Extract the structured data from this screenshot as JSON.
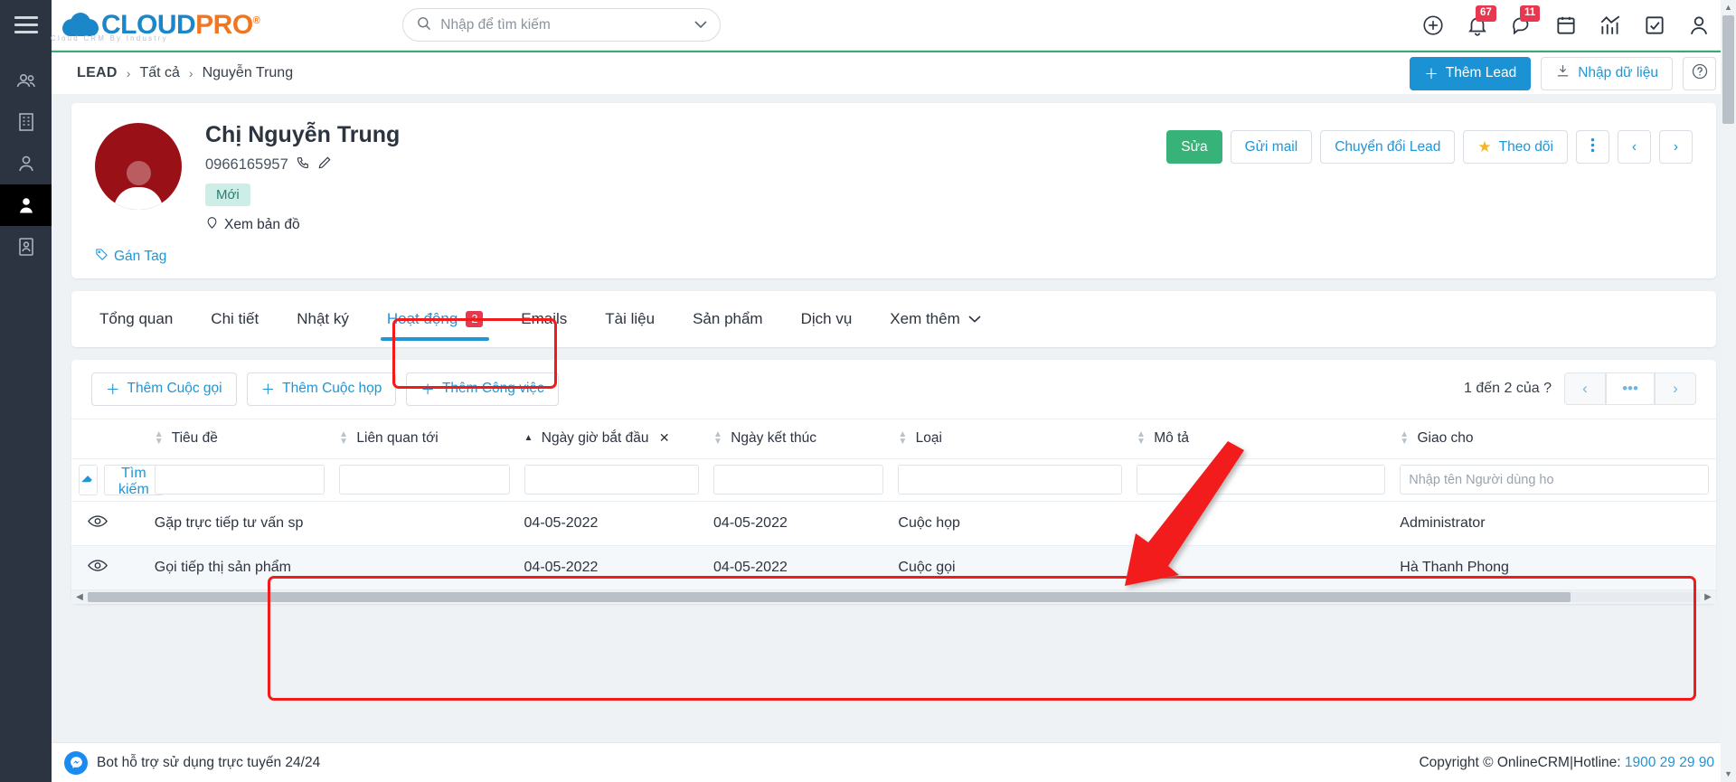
{
  "topbar": {
    "logo_main": "CLOUD",
    "logo_accent": "PRO",
    "logo_reg": "®",
    "logo_tagline": "Cloud CRM By Industry",
    "search_placeholder": "Nhập để tìm kiếm",
    "search_value": "",
    "icons": [
      {
        "name": "add-circle-icon",
        "badge": ""
      },
      {
        "name": "bell-icon",
        "badge": "67"
      },
      {
        "name": "chat-icon",
        "badge": "11"
      },
      {
        "name": "calendar-icon",
        "badge": ""
      },
      {
        "name": "chart-icon",
        "badge": ""
      },
      {
        "name": "task-check-icon",
        "badge": ""
      },
      {
        "name": "user-account-icon",
        "badge": ""
      }
    ]
  },
  "rail": {
    "items": [
      {
        "name": "contacts-icon"
      },
      {
        "name": "company-icon"
      },
      {
        "name": "person-icon"
      },
      {
        "name": "lead-icon"
      },
      {
        "name": "document-icon"
      }
    ]
  },
  "breadcrumb": {
    "root": "LEAD",
    "sep": "›",
    "level2": "Tất cả",
    "level3": "Nguyễn Trung"
  },
  "header_actions": {
    "add_lead": "Thêm Lead",
    "import": "Nhập dữ liệu",
    "help": "?"
  },
  "profile": {
    "name": "Chị Nguyễn Trung",
    "phone": "0966165957",
    "status_badge": "Mới",
    "map_link": "Xem bản đồ",
    "tag_link": "Gán Tag",
    "actions": {
      "edit": "Sửa",
      "send_mail": "Gửi mail",
      "convert": "Chuyển đổi Lead",
      "follow": "Theo dõi",
      "more": "⋮",
      "prev": "‹",
      "next": "›"
    }
  },
  "tabs": [
    {
      "label": "Tổng quan",
      "badge": "",
      "active": false
    },
    {
      "label": "Chi tiết",
      "badge": "",
      "active": false
    },
    {
      "label": "Nhật ký",
      "badge": "",
      "active": false
    },
    {
      "label": "Hoạt động",
      "badge": "2",
      "active": true
    },
    {
      "label": "Emails",
      "badge": "",
      "active": false
    },
    {
      "label": "Tài liệu",
      "badge": "",
      "active": false
    },
    {
      "label": "Sản phẩm",
      "badge": "",
      "active": false
    },
    {
      "label": "Dịch vụ",
      "badge": "",
      "active": false
    },
    {
      "label": "Xem thêm",
      "badge": "",
      "active": false,
      "chevron": true
    }
  ],
  "table_toolbar": {
    "add_call": "Thêm Cuộc gọi",
    "add_meeting": "Thêm Cuộc họp",
    "add_task": "Thêm Công việc",
    "pagination_text": "1 đến 2 của ?",
    "prev": "‹",
    "dots": "•••",
    "next": "›"
  },
  "table": {
    "search_button": "Tìm kiếm",
    "columns": [
      {
        "label": "",
        "key": "eye"
      },
      {
        "label": "Tiêu đề",
        "sorted": false
      },
      {
        "label": "Liên quan tới",
        "sorted": false
      },
      {
        "label": "Ngày giờ bắt đầu",
        "sorted": true,
        "sort_dir": "asc",
        "clearable": true
      },
      {
        "label": "Ngày kết thúc",
        "sorted": false
      },
      {
        "label": "Loại",
        "sorted": false
      },
      {
        "label": "Mô tả",
        "sorted": false
      },
      {
        "label": "Giao cho",
        "sorted": false
      }
    ],
    "filters": {
      "tieu_de": "",
      "lien_quan_toi": "",
      "ngay_bat_dau": "",
      "ngay_ket_thuc": "",
      "loai": "",
      "mo_ta": "",
      "giao_cho_placeholder": "Nhập tên Người dùng ho"
    },
    "rows": [
      {
        "title": "Gặp trực tiếp tư vấn sp",
        "related": "",
        "start_date": "04-05-2022",
        "end_date": "04-05-2022",
        "type": "Cuộc họp",
        "description": "",
        "assigned_to": "Administrator"
      },
      {
        "title": "Gọi tiếp thị sản phẩm",
        "related": "",
        "start_date": "04-05-2022",
        "end_date": "04-05-2022",
        "type": "Cuộc gọi",
        "description": "",
        "assigned_to": "Hà Thanh Phong"
      }
    ]
  },
  "footer": {
    "support_text": "Bot hỗ trợ sử dụng trực tuyến 24/24",
    "copyright": "Copyright © OnlineCRM",
    "sep": "|",
    "hotline_label": "Hotline:",
    "hotline_number": "1900 29 29 90"
  },
  "colors": {
    "accent_blue": "#2096d6",
    "green": "#37b278",
    "red_badge": "#e8384f",
    "annotation_red": "#f21b1b",
    "rail_dark": "#2b3440",
    "avatar_red": "#9a1017"
  }
}
